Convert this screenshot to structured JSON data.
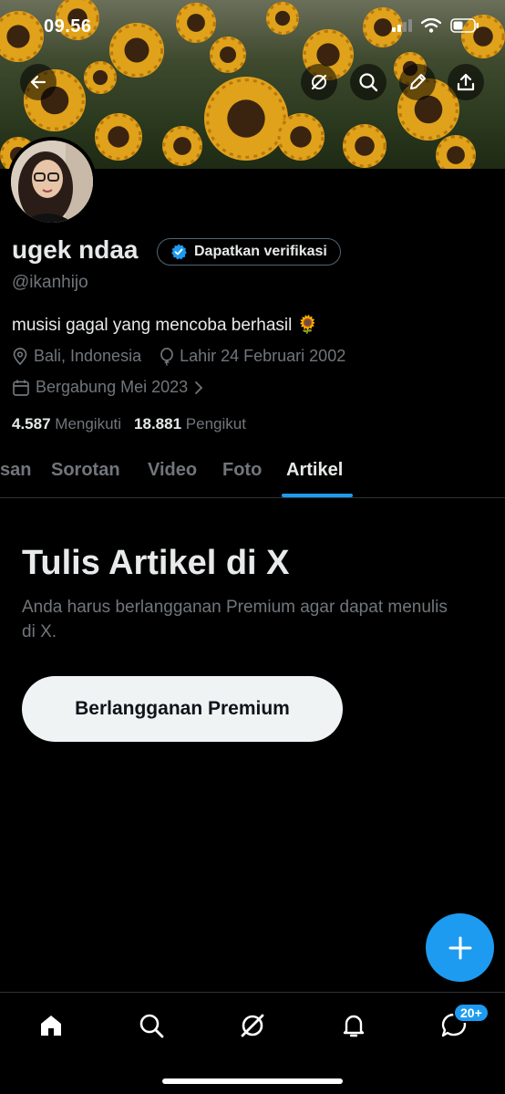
{
  "status_bar": {
    "time": "09.56"
  },
  "profile": {
    "name": "ugek ndaa",
    "verify_label": "Dapatkan verifikasi",
    "handle": "@ikanhijo",
    "bio": "musisi gagal yang mencoba berhasil 🌻",
    "location": "Bali, Indonesia",
    "birth": "Lahir 24 Februari 2002",
    "joined": "Bergabung Mei 2023",
    "following_count": "4.587",
    "following_label": "Mengikuti",
    "followers_count": "18.881",
    "followers_label": "Pengikut"
  },
  "tabs": [
    {
      "label": "san",
      "active": false
    },
    {
      "label": "Sorotan",
      "active": false
    },
    {
      "label": "Video",
      "active": false
    },
    {
      "label": "Foto",
      "active": false
    },
    {
      "label": "Artikel",
      "active": true
    }
  ],
  "promo": {
    "title": "Tulis Artikel di X",
    "description": "Anda harus berlangganan Premium agar dapat menulis di X.",
    "button_label": "Berlangganan Premium"
  },
  "bottom_nav": {
    "items": [
      "home-icon",
      "search-icon",
      "grok-icon",
      "notifications-icon",
      "messages-icon"
    ],
    "messages_badge": "20+"
  },
  "colors": {
    "accent": "#1d9bf0",
    "background": "#000000",
    "muted": "#71767b"
  }
}
